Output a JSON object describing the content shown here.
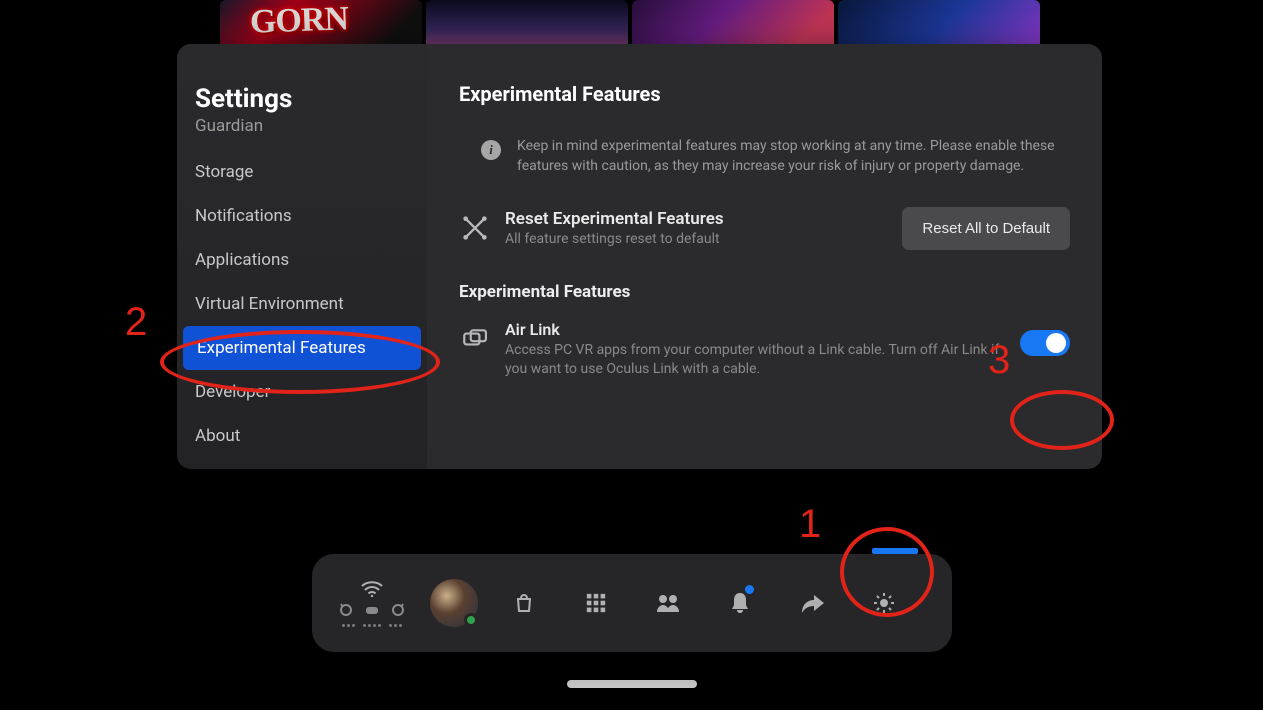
{
  "bg": {
    "title_overlay": "GORN"
  },
  "sidebar": {
    "title": "Settings",
    "peek_item": "Guardian",
    "items": [
      {
        "label": "Storage"
      },
      {
        "label": "Notifications"
      },
      {
        "label": "Applications"
      },
      {
        "label": "Virtual Environment"
      },
      {
        "label": "Experimental Features",
        "active": true
      },
      {
        "label": "Developer"
      },
      {
        "label": "About"
      }
    ]
  },
  "content": {
    "heading": "Experimental Features",
    "warning": "Keep in mind experimental features may stop working at any time. Please enable these features with caution, as they may increase your risk of injury or property damage.",
    "reset": {
      "title": "Reset Experimental Features",
      "subtitle": "All feature settings reset to default",
      "button": "Reset All to Default"
    },
    "section_heading": "Experimental Features",
    "airlink": {
      "title": "Air Link",
      "desc": "Access PC VR apps from your computer without a Link cable. Turn off Air Link if you want to use Oculus Link with a cable.",
      "enabled": true
    }
  },
  "annotations": {
    "n1": "1",
    "n2": "2",
    "n3": "3"
  }
}
